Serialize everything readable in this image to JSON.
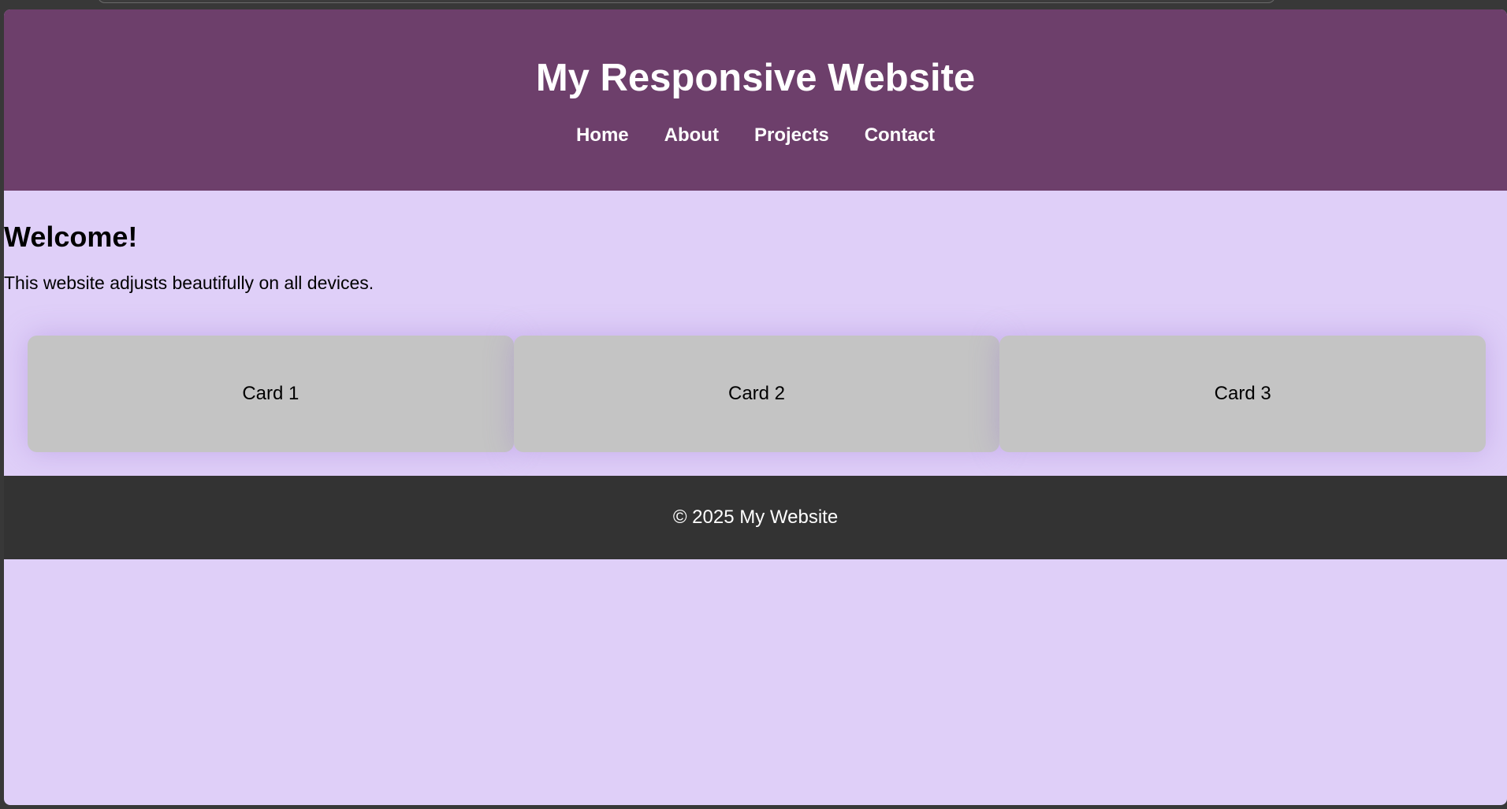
{
  "header": {
    "title": "My Responsive Website",
    "nav": [
      {
        "label": "Home"
      },
      {
        "label": "About"
      },
      {
        "label": "Projects"
      },
      {
        "label": "Contact"
      }
    ]
  },
  "main": {
    "heading": "Welcome!",
    "tagline": "This website adjusts beautifully on all devices.",
    "cards": [
      {
        "label": "Card 1"
      },
      {
        "label": "Card 2"
      },
      {
        "label": "Card 3"
      }
    ]
  },
  "footer": {
    "text": "© 2025 My Website"
  },
  "colors": {
    "header_bg": "#6d3f6b",
    "page_bg": "#dfcff8",
    "card_bg": "#c4c4c4",
    "footer_bg": "#333333"
  }
}
